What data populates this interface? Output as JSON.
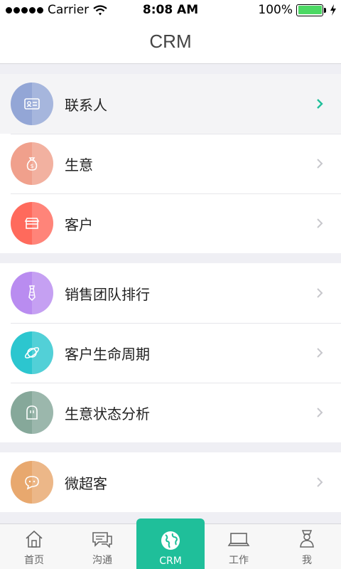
{
  "status": {
    "carrier": "Carrier",
    "time": "8:08 AM",
    "battery": "100%"
  },
  "header": {
    "title": "CRM"
  },
  "menu": {
    "contacts": "联系人",
    "business": "生意",
    "customers": "客户",
    "sales_ranking": "销售团队排行",
    "customer_lifecycle": "客户生命周期",
    "business_status": "生意状态分析",
    "micro_customer": "微超客"
  },
  "tabs": {
    "home": "首页",
    "chat": "沟通",
    "crm": "CRM",
    "work": "工作",
    "me": "我"
  },
  "colors": {
    "accent": "#1fbf9a",
    "contacts": "#93a6d6",
    "business": "#f0a08c",
    "customers": "#ff6a5c",
    "sales_ranking": "#b98cf0",
    "customer_lifecycle": "#2cc6cf",
    "business_status": "#86a89a",
    "micro_customer": "#e8a86e"
  }
}
